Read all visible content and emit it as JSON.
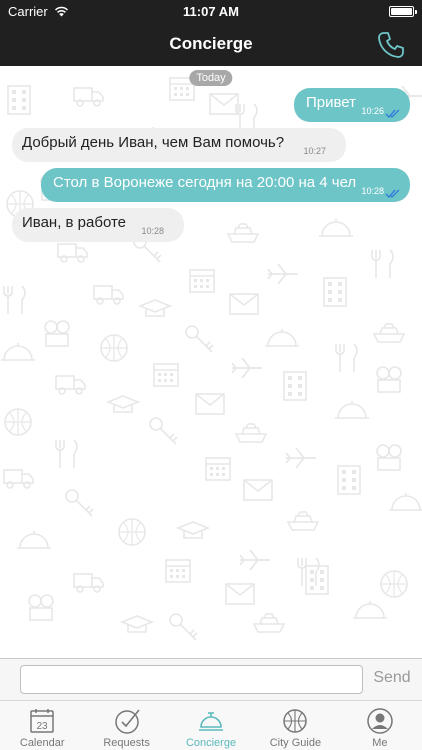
{
  "status_bar": {
    "carrier": "Carrier",
    "time": "11:07 AM"
  },
  "nav": {
    "title": "Concierge",
    "call_icon": "phone-icon"
  },
  "chat": {
    "date_separator": "Today",
    "messages": [
      {
        "direction": "outgoing",
        "text": "Привет",
        "time": "10:26",
        "read": true
      },
      {
        "direction": "incoming",
        "text": "Добрый день Иван, чем Вам помочь?",
        "time": "10:27"
      },
      {
        "direction": "outgoing",
        "text": "Стол в Воронеже сегодня на 20:00 на 4 чел",
        "time": "10:28",
        "read": true
      },
      {
        "direction": "incoming",
        "text": "Иван, в работе",
        "time": "10:28"
      }
    ]
  },
  "input": {
    "placeholder": "",
    "value": "",
    "send_label": "Send"
  },
  "tabs": [
    {
      "label": "Calendar",
      "icon": "calendar-icon",
      "badge": "23",
      "active": false
    },
    {
      "label": "Requests",
      "icon": "checkmark-circle-icon",
      "active": false
    },
    {
      "label": "Concierge",
      "icon": "service-bell-icon",
      "active": true
    },
    {
      "label": "City Guide",
      "icon": "globe-icon",
      "active": false
    },
    {
      "label": "Me",
      "icon": "user-icon",
      "active": false
    }
  ],
  "colors": {
    "accent": "#6ec5c8",
    "bar_dark": "#202020",
    "incoming_bubble": "#efefef",
    "tab_active": "#5ab9bc"
  }
}
